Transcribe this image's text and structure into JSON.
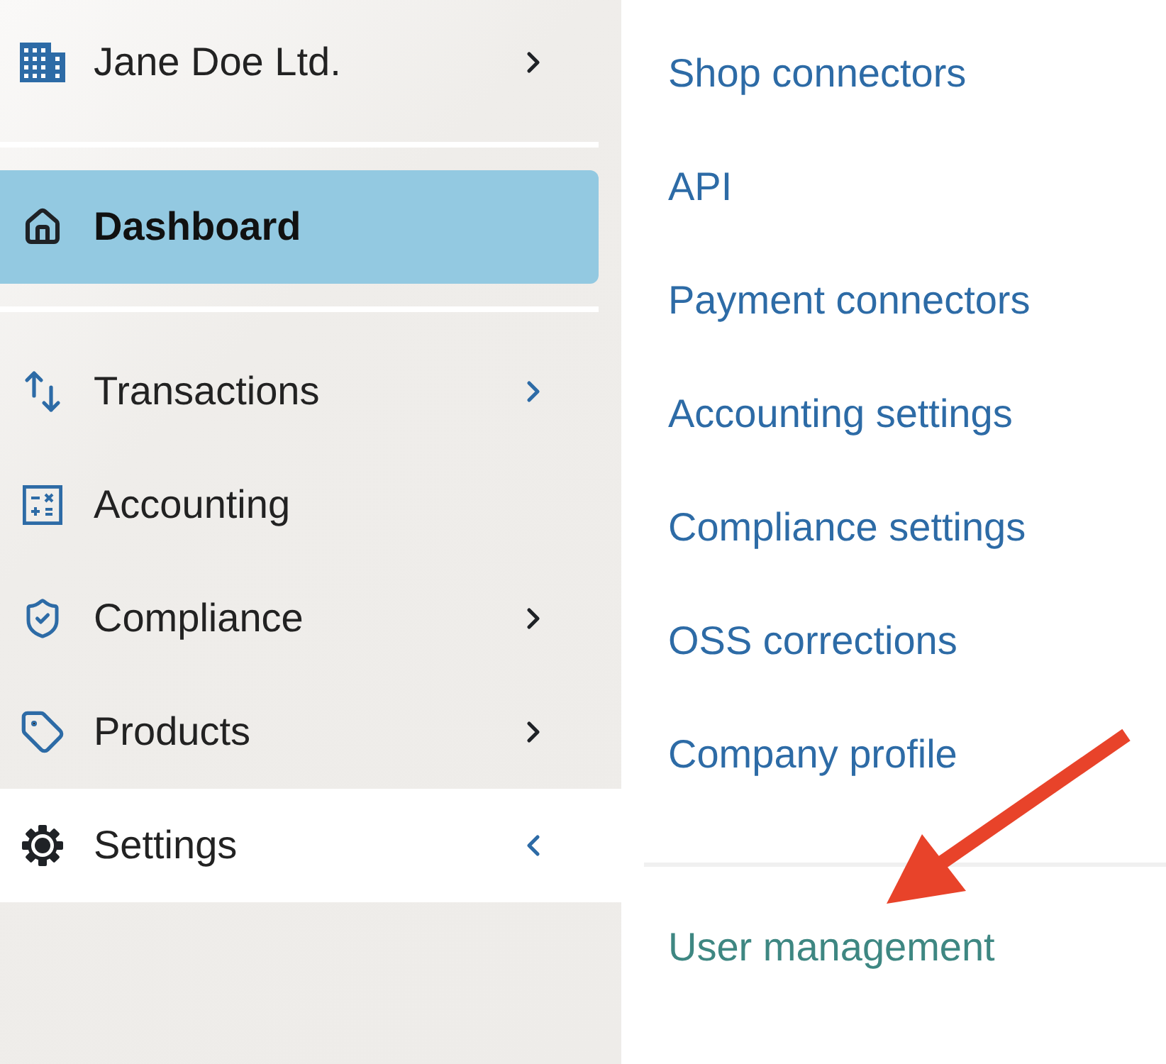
{
  "company": {
    "name": "Jane Doe Ltd."
  },
  "nav_sections": [
    {
      "items": [
        {
          "label": "Dashboard",
          "selected": true,
          "expanded": false
        }
      ]
    },
    {
      "items": [
        {
          "label": "Transactions",
          "selected": false,
          "expanded": false,
          "chevron": {
            "highlighted": true
          }
        },
        {
          "label": "Accounting",
          "selected": false,
          "expanded": false
        },
        {
          "label": "Compliance",
          "selected": false,
          "expanded": false,
          "chevron": {
            "highlighted": false
          }
        },
        {
          "label": "Products",
          "selected": false,
          "expanded": false,
          "chevron": {
            "highlighted": false
          }
        },
        {
          "label": "Settings",
          "selected": false,
          "expanded": true,
          "chevron": {
            "highlighted": true
          }
        }
      ]
    }
  ],
  "settings_menu": {
    "sections": [
      {
        "items": [
          {
            "label": "Shop connectors",
            "selected": false
          },
          {
            "label": "API",
            "selected": false
          },
          {
            "label": "Payment connectors",
            "selected": false
          },
          {
            "label": "Accounting settings",
            "selected": false
          },
          {
            "label": "Compliance settings",
            "selected": false
          },
          {
            "label": "OSS corrections",
            "selected": false
          },
          {
            "label": "Company profile",
            "selected": false
          }
        ]
      },
      {
        "items": [
          {
            "label": "User management",
            "selected": true
          }
        ]
      }
    ]
  }
}
